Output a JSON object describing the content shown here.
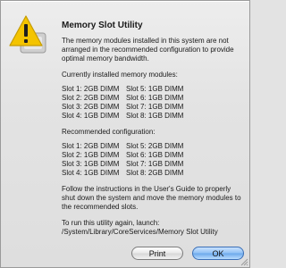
{
  "dialog": {
    "title": "Memory Slot Utility",
    "message": "The memory modules installed in this system are not arranged in the recommended configuration to provide optimal memory bandwidth.",
    "installed_heading": "Currently installed memory modules:",
    "installed_slots": [
      "Slot 1: 2GB DIMM",
      "Slot 5: 1GB DIMM",
      "Slot 2: 2GB DIMM",
      "Slot 6: 1GB DIMM",
      "Slot 3: 2GB DIMM",
      "Slot 7: 1GB DIMM",
      "Slot 4: 1GB DIMM",
      "Slot 8: 1GB DIMM"
    ],
    "recommended_heading": "Recommended configuration:",
    "recommended_slots": [
      "Slot 1: 2GB DIMM",
      "Slot 5: 2GB DIMM",
      "Slot 2: 1GB DIMM",
      "Slot 6: 1GB DIMM",
      "Slot 3: 1GB DIMM",
      "Slot 7: 1GB DIMM",
      "Slot 4: 1GB DIMM",
      "Slot 8: 2GB DIMM"
    ],
    "instructions": "Follow the instructions in the User's Guide to properly shut down the system and move the memory modules to the recommended slots.",
    "rerun_label": "To run this utility again, launch:",
    "rerun_path": "/System/Library/CoreServices/Memory Slot Utility",
    "print_button": "Print",
    "ok_button": "OK"
  },
  "icons": {
    "warning": "warning-icon"
  },
  "colors": {
    "warning_yellow": "#f4c400",
    "default_button": "#7fb5ef"
  }
}
